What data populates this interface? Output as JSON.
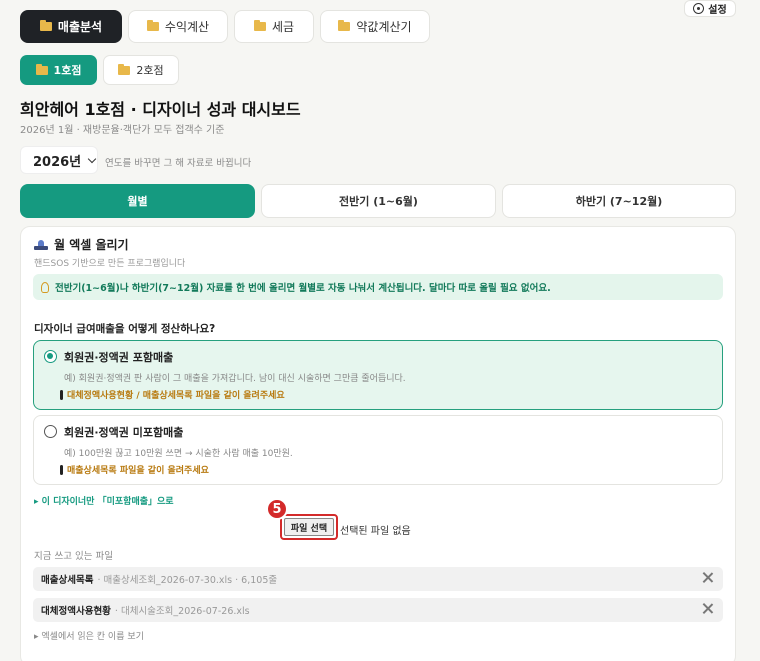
{
  "settings": {
    "label": "설정",
    "icon": "gear-icon"
  },
  "main_tabs": [
    {
      "label": "매출분석",
      "active": true,
      "icon": "folder-icon"
    },
    {
      "label": "수익계산",
      "active": false,
      "icon": "folder-icon"
    },
    {
      "label": "세금",
      "active": false,
      "icon": "folder-icon"
    },
    {
      "label": "약값계산기",
      "active": false,
      "icon": "folder-icon"
    }
  ],
  "store_tabs": [
    {
      "label": "1호점",
      "active": true,
      "icon": "folder-icon"
    },
    {
      "label": "2호점",
      "active": false,
      "icon": "folder-icon"
    }
  ],
  "page": {
    "title": "희안헤어 1호점 · 디자이너 성과 대시보드",
    "subtitle": "2026년 1월 · 재방문율·객단가 모두 접객수 기준"
  },
  "year_select": {
    "value": "2026년",
    "hint": "연도를 바꾸면 그 해 자료로 바뀝니다"
  },
  "period_tabs": [
    {
      "label": "월별",
      "active": true
    },
    {
      "label": "전반기 (1~6월)",
      "active": false
    },
    {
      "label": "하반기 (7~12월)",
      "active": false
    }
  ],
  "upload": {
    "title": "월 엑셀 올리기",
    "subtitle": "핸드SOS 기반으로 만든 프로그램입니다",
    "tip": "전반기(1~6월)나 하반기(7~12월) 자료를 한 번에 올리면 월별로 자동 나눠서 계산됩니다. 달마다 따로 올릴 필요 없어요.",
    "question": "디자이너 급여매출을 어떻게 정산하나요?",
    "options": [
      {
        "title": "회원권·정액권 포함매출",
        "desc": "예) 회원권·정액권 판 사람이 그 매출을 가져갑니다. 남이 대신 시술하면 그만큼 줄어듭니다.",
        "note": "대체정액사용현황 / 매출상세목록 파일을 같이 올려주세요",
        "selected": true
      },
      {
        "title": "회원권·정액권 미포함매출",
        "desc": "예) 100만원 끊고 10만원 쓰면 → 시술한 사람 매출 10만원.",
        "note": "매출상세목록 파일을 같이 올려주세요",
        "selected": false
      }
    ],
    "link": "▸ 이 디자이너만 「미포함매출」으로",
    "step_badge": "5",
    "file_button": "파일 선택",
    "no_file": "선택된 파일 없음",
    "current_label": "지금 쓰고 있는 파일",
    "files": [
      {
        "name": "매출상세목록",
        "info": "· 매출상세조회_2026-07-30.xls · 6,105줄"
      },
      {
        "name": "대체정액사용현황",
        "info": "· 대체시술조회_2026-07-26.xls"
      }
    ],
    "column_names": "▸ 엑셀에서 읽은 칸 이름 보기"
  }
}
